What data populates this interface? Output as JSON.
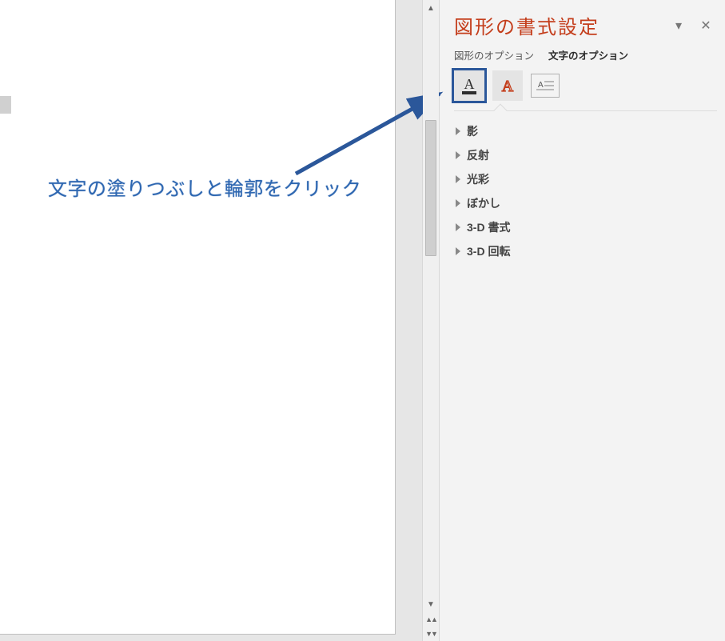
{
  "annotation": {
    "text": "文字の塗りつぶしと輪郭をクリック"
  },
  "panel": {
    "title": "図形の書式設定",
    "tabs": {
      "shape": "図形のオプション",
      "text": "文字のオプション"
    },
    "icons": {
      "textFillOutline": "text-fill-outline-icon",
      "textEffects": "text-effects-icon",
      "textBox": "textbox-icon"
    },
    "props": [
      {
        "label": "影"
      },
      {
        "label": "反射"
      },
      {
        "label": "光彩"
      },
      {
        "label": "ぼかし"
      },
      {
        "label": "3-D 書式"
      },
      {
        "label": "3-D 回転"
      }
    ]
  }
}
